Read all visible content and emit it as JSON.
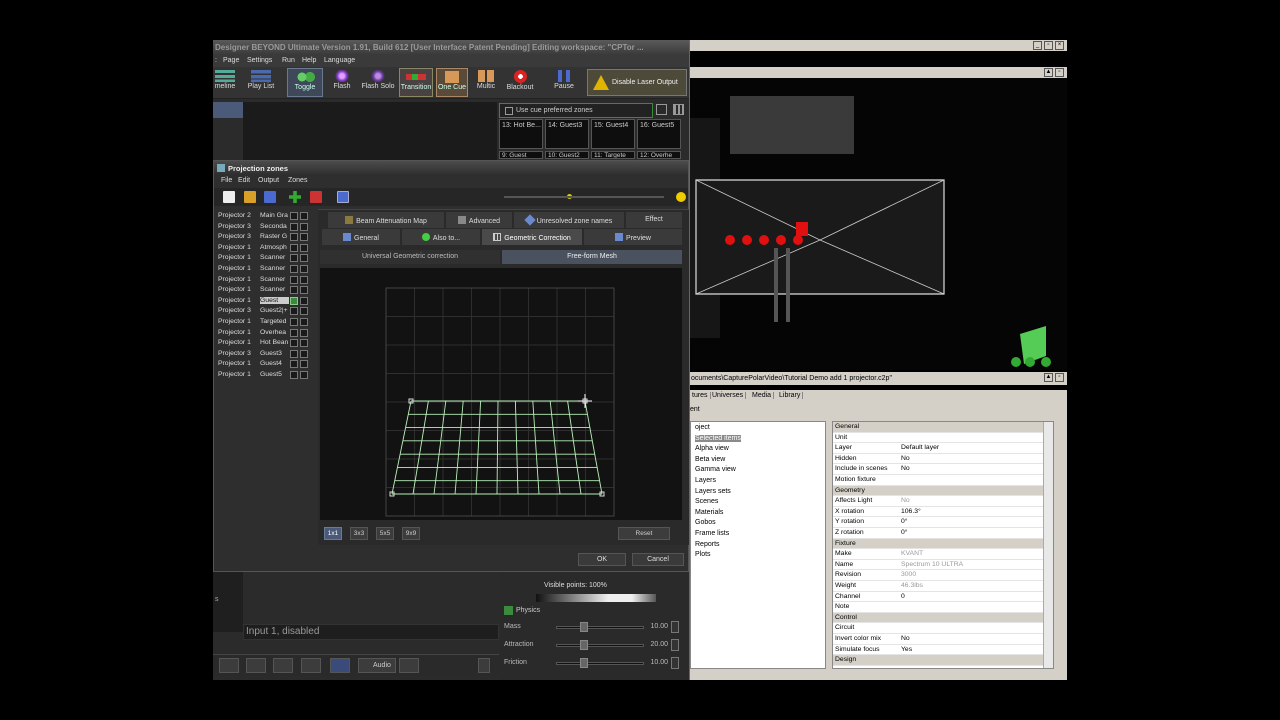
{
  "beyond": {
    "title": "Designer BEYOND Ultimate   Version 1.91, Build 612   [User Interface Patent Pending]   Editing workspace: \"CPTor ... ",
    "menu": [
      "Page",
      "Settings",
      "Run",
      "Help",
      "Language"
    ],
    "toolbar": [
      {
        "label": "meline",
        "icon": "timeline-icon"
      },
      {
        "label": "Play List",
        "icon": "playlist-icon"
      },
      {
        "label": "Toggle",
        "icon": "toggle-icon"
      },
      {
        "label": "Flash",
        "icon": "flash-icon"
      },
      {
        "label": "Flash Solo",
        "icon": "flash-solo-icon"
      },
      {
        "label": "Transition",
        "icon": "transition-icon"
      },
      {
        "label": "One Cue",
        "icon": "one-cue-icon"
      },
      {
        "label": "Multic",
        "icon": "multi-cue-icon"
      },
      {
        "label": "Blackout",
        "icon": "blackout-icon"
      },
      {
        "label": "Pause",
        "icon": "pause-icon"
      }
    ],
    "disable_laser": "Disable Laser Output",
    "cue_pref_label": "Use cue preferred zones",
    "cue_cells": [
      "13: Hot Be...",
      "14: Guest3",
      "15: Guest4",
      "16: Guest5"
    ],
    "cue_cells_row2": [
      "9: Guest",
      "10: Guest2",
      "11: Targete",
      "12: Overhe"
    ],
    "input_status": "Input 1, disabled",
    "visible_points": "Visible points: 100%",
    "physics_label": "Physics",
    "physics": [
      {
        "label": "Mass",
        "value": "10.00"
      },
      {
        "label": "Attraction",
        "value": "20.00"
      },
      {
        "label": "Friction",
        "value": "10.00"
      }
    ],
    "audio_label": "Audio",
    "side_label": "s"
  },
  "pz": {
    "title": "Projection zones",
    "menu": [
      "File",
      "Edit",
      "Output",
      "Zones"
    ],
    "zones": [
      {
        "proj": "Projector 2",
        "name": "Main Gra"
      },
      {
        "proj": "Projector 3",
        "name": "Seconda"
      },
      {
        "proj": "Projector 3",
        "name": "Raster G"
      },
      {
        "proj": "Projector 1",
        "name": "Atmosph"
      },
      {
        "proj": "Projector 1",
        "name": "Scanner"
      },
      {
        "proj": "Projector 1",
        "name": "Scanner"
      },
      {
        "proj": "Projector 1",
        "name": "Scanner"
      },
      {
        "proj": "Projector 1",
        "name": "Scanner"
      },
      {
        "proj": "Projector 1",
        "name": "Guest",
        "selected": true
      },
      {
        "proj": "Projector 3",
        "name": "Guest2|+"
      },
      {
        "proj": "Projector 1",
        "name": "Targeted"
      },
      {
        "proj": "Projector 1",
        "name": "Overhea"
      },
      {
        "proj": "Projector 1",
        "name": "Hot Bean"
      },
      {
        "proj": "Projector 3",
        "name": "Guest3"
      },
      {
        "proj": "Projector 1",
        "name": "Guest4"
      },
      {
        "proj": "Projector 1",
        "name": "Guest5"
      }
    ],
    "tabs_row1": [
      "Beam Attenuation Map",
      "Advanced",
      "Unresolved zone names",
      "Effect"
    ],
    "tabs_row2": [
      "General",
      "Also to...",
      "Geometric Correction",
      "Preview"
    ],
    "subtabs": [
      "Universal Geometric correction",
      "Free-form Mesh"
    ],
    "grid_buttons": [
      "1x1",
      "3x3",
      "5x5",
      "9x9"
    ],
    "reset": "Reset",
    "ok": "OK",
    "cancel": "Cancel"
  },
  "viz": {
    "file_path": "ocuments\\CapturePolarVideo\\Tutorial Demo add 1 projector.c2p\"",
    "lib_tabs": [
      "tures",
      "Universes",
      "Media",
      "Library"
    ],
    "tree_header": "ent",
    "tree": [
      "oject",
      "Selected items",
      "Alpha view",
      "Beta view",
      "Gamma view",
      "Layers",
      "Layers sets",
      "Scenes",
      "Materials",
      "Gobos",
      "Frame lists",
      "Reports",
      "Plots"
    ],
    "props": [
      {
        "k": "General",
        "cat": true
      },
      {
        "k": "Unit",
        "v": ""
      },
      {
        "k": "Layer",
        "v": "Default layer"
      },
      {
        "k": "Hidden",
        "v": "No"
      },
      {
        "k": "Include in scenes",
        "v": "No"
      },
      {
        "k": "Motion fixture",
        "v": ""
      },
      {
        "k": "Geometry",
        "cat": true
      },
      {
        "k": "Affects Light",
        "v": "No",
        "dim": true
      },
      {
        "k": "X rotation",
        "v": "106.3°"
      },
      {
        "k": "Y rotation",
        "v": "0°"
      },
      {
        "k": "Z rotation",
        "v": "0°"
      },
      {
        "k": "Fixture",
        "cat": true
      },
      {
        "k": "Make",
        "v": "KVANT",
        "dim": true
      },
      {
        "k": "Name",
        "v": "Spectrum 10 ULTRA",
        "dim": true
      },
      {
        "k": "Revision",
        "v": "3000",
        "dim": true
      },
      {
        "k": "Weight",
        "v": "46.3lbs",
        "dim": true
      },
      {
        "k": "Channel",
        "v": "0"
      },
      {
        "k": "Note",
        "v": ""
      },
      {
        "k": "Control",
        "cat": true
      },
      {
        "k": "Circuit",
        "v": ""
      },
      {
        "k": "Invert color mix",
        "v": "No"
      },
      {
        "k": "Simulate focus",
        "v": "Yes"
      },
      {
        "k": "Design",
        "cat": true
      }
    ]
  },
  "colors": {
    "accent": "#4a5a78",
    "mesh": "#b8f0b8",
    "laser_red": "#e01010",
    "green": "#3c8a3c"
  }
}
